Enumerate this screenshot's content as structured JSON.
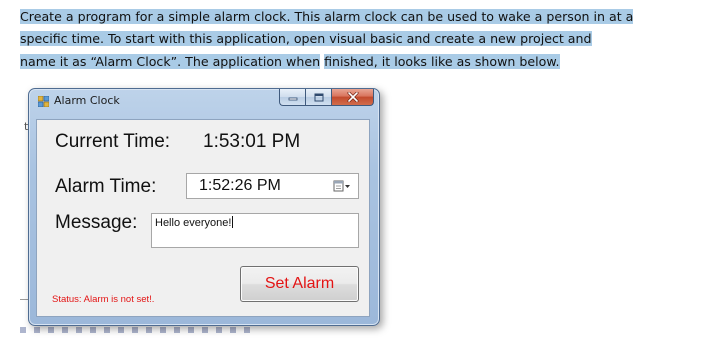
{
  "document": {
    "line1": "Create a program for a simple alarm clock. This alarm clock can be used to wake a person in at a",
    "line2": "specific time. To start with this application, open visual basic and create a new project and",
    "line3_a": "name it as “Alarm Clock”. The application when",
    "line3_b": " ",
    "line3_c": "finished, it looks like as shown below.",
    "stray_char": "t"
  },
  "window": {
    "title": "Alarm Clock",
    "controls": [
      "minimize",
      "maximize",
      "close"
    ]
  },
  "form": {
    "current_time_label": "Current Time:",
    "current_time_value": "1:53:01 PM",
    "alarm_time_label": "Alarm Time:",
    "alarm_time_value": "1:52:26 PM",
    "message_label": "Message:",
    "message_value": "Hello everyone!",
    "set_alarm_button": "Set Alarm",
    "status": "Status: Alarm is not set!."
  },
  "colors": {
    "selection": "#a9cbe6",
    "status_text": "#e31414",
    "button_text": "#e31414"
  },
  "icons": {
    "app": "app-form-icon",
    "picker": "calendar-dropdown-icon"
  }
}
